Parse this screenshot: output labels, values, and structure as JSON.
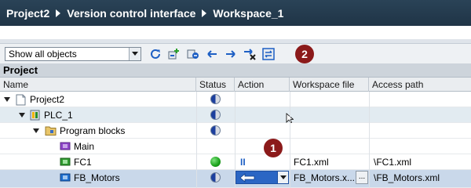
{
  "breadcrumb": {
    "items": [
      "Project2",
      "Version control interface",
      "Workspace_1"
    ]
  },
  "toolbar": {
    "filter_value": "Show all objects",
    "badge_text": "2",
    "buttons": [
      "refresh-icon",
      "add-to-workspace-icon",
      "export-icon",
      "import-left-icon",
      "import-right-icon",
      "sync-remove-icon",
      "compare-icon"
    ]
  },
  "section": {
    "title": "Project"
  },
  "columns": {
    "name": "Name",
    "status": "Status",
    "action": "Action",
    "workspace_file": "Workspace file",
    "access_path": "Access path"
  },
  "rows": [
    {
      "name": "Project2",
      "workspace_file": "",
      "access_path": ""
    },
    {
      "name": "PLC_1",
      "workspace_file": "",
      "access_path": ""
    },
    {
      "name": "Program blocks",
      "workspace_file": "",
      "access_path": ""
    },
    {
      "name": "Main",
      "workspace_file": "",
      "access_path": ""
    },
    {
      "name": "FC1",
      "action": "II",
      "workspace_file": "FC1.xml",
      "access_path": "\\FC1.xml"
    },
    {
      "name": "FB_Motors",
      "workspace_file": "FB_Motors.x...",
      "ellipsis": "...",
      "access_path": "\\FB_Motors.xml"
    }
  ],
  "callout": {
    "text": "1"
  },
  "colors": {
    "titlebar": "#24394d",
    "badge": "#8b1a1a",
    "selected_row": "#c9d8ea",
    "highlight_row": "#e2ebf1",
    "status_blue": "#1c3f9e",
    "status_green": "#19a119"
  }
}
